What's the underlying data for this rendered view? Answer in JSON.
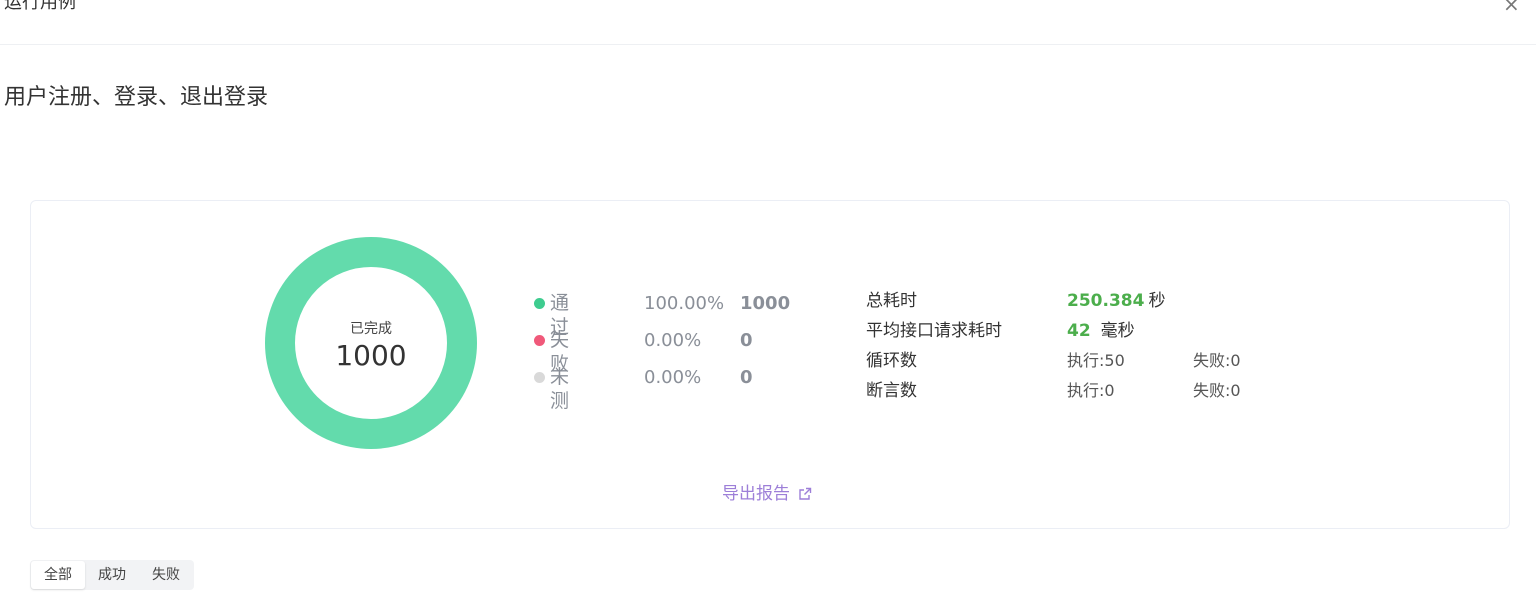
{
  "dialog": {
    "title": "运行用例",
    "close_glyph": "×"
  },
  "case_title": "用户注册、登录、退出登录",
  "summary": {
    "donut": {
      "label": "已完成",
      "value": "1000",
      "color": "#63dbac"
    },
    "legend": [
      {
        "label": "通过",
        "percent": "100.00%",
        "count": "1000",
        "color": "#3ecc8f"
      },
      {
        "label": "失败",
        "percent": "0.00%",
        "count": "0",
        "color": "#f0597a"
      },
      {
        "label": "未测",
        "percent": "0.00%",
        "count": "0",
        "color": "#d9d9d9"
      }
    ],
    "stats": {
      "total_time": {
        "label": "总耗时",
        "value": "250.384",
        "unit": "秒"
      },
      "avg_request_time": {
        "label": "平均接口请求耗时",
        "value": "42",
        "unit": "毫秒"
      },
      "loops": {
        "label": "循环数",
        "executed": "执行:50",
        "failed": "失败:0"
      },
      "assertions": {
        "label": "断言数",
        "executed": "执行:0",
        "failed": "失败:0"
      }
    },
    "export_label": "导出报告",
    "export_icon": "external-link-icon"
  },
  "filter_tabs": [
    {
      "label": "全部",
      "active": true
    },
    {
      "label": "成功",
      "active": false
    },
    {
      "label": "失败",
      "active": false
    }
  ],
  "colors": {
    "accent_green": "#4cae4c",
    "export_purple": "#9d7fd8"
  }
}
